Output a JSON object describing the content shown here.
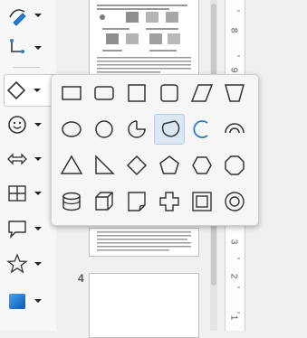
{
  "toolbar": {
    "tools": [
      {
        "icon": "curve-pen-icon",
        "name": "curves-and-polygons"
      },
      {
        "icon": "connector-icon",
        "name": "connectors"
      },
      {
        "icon": "diamond-icon",
        "name": "basic-shapes"
      },
      {
        "icon": "smiley-icon",
        "name": "symbol-shapes"
      },
      {
        "icon": "double-arrow-icon",
        "name": "block-arrows"
      },
      {
        "icon": "flowchart-icon",
        "name": "flowchart"
      },
      {
        "icon": "callout-icon",
        "name": "callouts"
      },
      {
        "icon": "star-icon",
        "name": "stars-and-banners"
      },
      {
        "icon": "3d-cube-icon",
        "name": "3d-objects"
      }
    ],
    "selected_tool": "basic-shapes"
  },
  "slides_panel": {
    "page_number": "4"
  },
  "ruler": {
    "labels": [
      "8",
      "9",
      "3",
      "2",
      "1"
    ]
  },
  "basic_shapes_popup": {
    "rows": [
      [
        "rectangle-icon",
        "rounded-rectangle-icon",
        "square-icon",
        "rounded-square-icon",
        "parallelogram-icon",
        "trapezoid-icon"
      ],
      [
        "ellipse-icon",
        "circle-icon",
        "circle-pie-icon",
        "block-arc-icon",
        "arc-icon",
        "circle-segment-icon"
      ],
      [
        "isosceles-triangle-icon",
        "right-triangle-icon",
        "diamond-icon",
        "pentagon-icon",
        "hexagon-icon",
        "octagon-icon"
      ],
      [
        "cylinder-icon",
        "cube-icon",
        "folded-corner-icon",
        "cross-icon",
        "frame-icon",
        "ring-icon"
      ]
    ],
    "selected": "block-arc-icon",
    "accent": "#2a7ed3"
  }
}
